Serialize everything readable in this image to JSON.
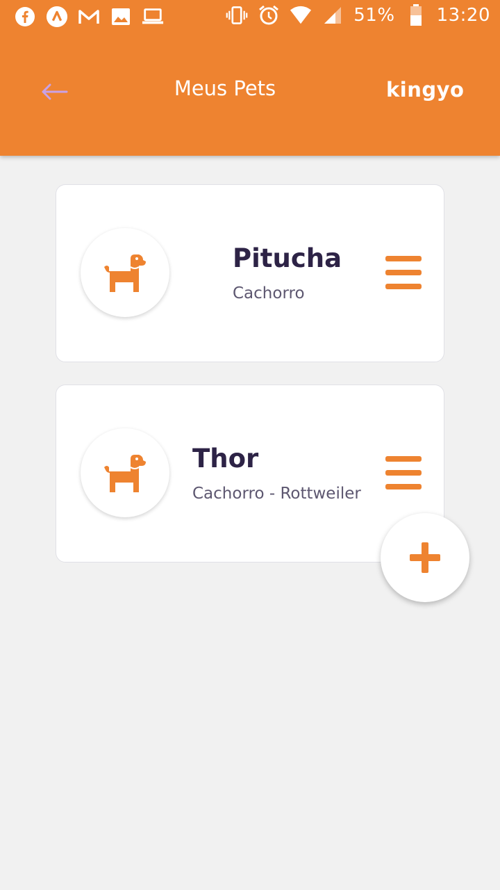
{
  "status_bar": {
    "icons_left": [
      "facebook-icon",
      "arc-icon",
      "gmail-icon",
      "image-icon",
      "laptop-icon"
    ],
    "icons_right": [
      "vibrate-icon",
      "alarm-icon",
      "wifi-icon",
      "signal-icon",
      "battery-icon"
    ],
    "battery_percent": "51%",
    "time": "13:20"
  },
  "header": {
    "title": "Meus Pets",
    "brand": "kingyo",
    "back_icon": "arrow-left-icon"
  },
  "pets": [
    {
      "name": "Pitucha",
      "description": "Cachorro",
      "icon": "dog-icon"
    },
    {
      "name": "Thor",
      "description": "Cachorro - Rottweiler",
      "icon": "dog-icon"
    }
  ],
  "fab": {
    "icon": "plus-icon"
  },
  "colors": {
    "accent": "#ee8330",
    "background": "#f1f1f1",
    "card": "#ffffff",
    "name_text": "#2d2346",
    "desc_text": "#5d5770",
    "back_arrow": "#c9a2e6"
  }
}
